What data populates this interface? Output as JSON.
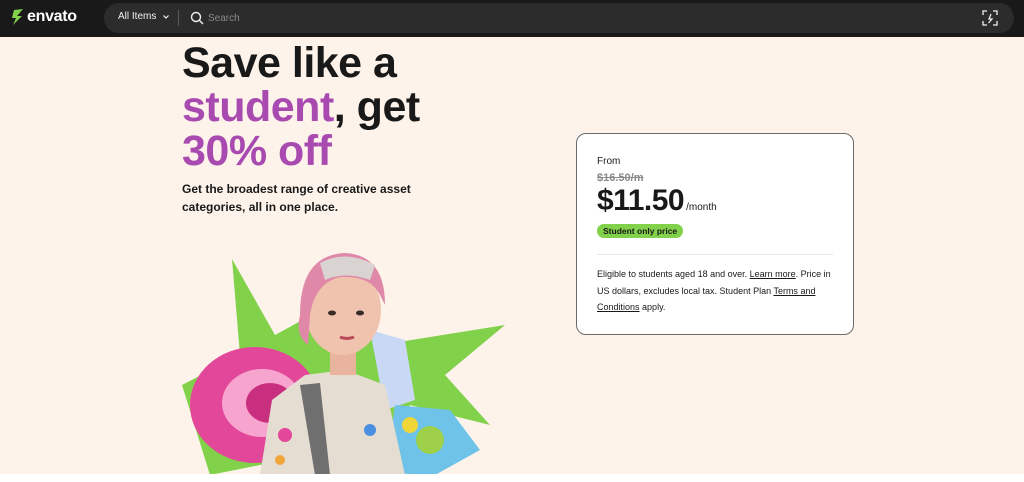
{
  "header": {
    "logo_text": "envato",
    "category_label": "All Items",
    "search_placeholder": "Search",
    "colors": {
      "bar": "#191919",
      "search_bg": "#2c2c2c",
      "logo_accent": "#82d14a"
    }
  },
  "hero": {
    "headline_line1": "Save like a",
    "headline_accent1": "student",
    "headline_mid": ", get",
    "headline_accent2": "30% off",
    "subline": "Get the broadest range of creative asset categories, all in one place.",
    "colors": {
      "background": "#fdf3ea",
      "accent": "#a84ab0"
    }
  },
  "pricing": {
    "from_label": "From",
    "old_price": "$16.50/m",
    "price": "$11.50",
    "period": "/month",
    "badge": "Student only price",
    "fine_print_part1": "Eligible to students aged 18 and over.",
    "learn_more": "Learn more",
    "fine_print_part2": ". Price in US dollars, excludes local tax. Student Plan",
    "terms_link": "Terms and Conditions",
    "fine_print_part3": "apply.",
    "colors": {
      "badge": "#82d14a"
    }
  },
  "icons": {
    "logo": "envato-leaf-icon",
    "dropdown": "chevron-down-icon",
    "search": "search-icon",
    "visual_search": "image-search-icon"
  }
}
